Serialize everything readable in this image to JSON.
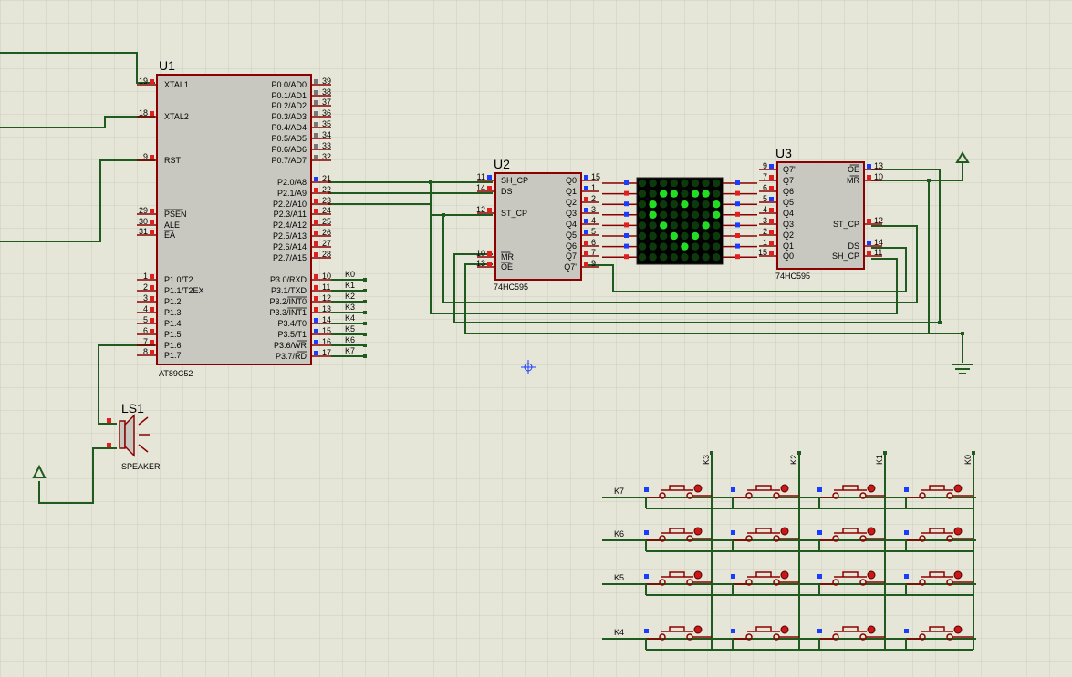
{
  "u1": {
    "ref": "U1",
    "part": "AT89C52",
    "left_pins": [
      {
        "num": "19",
        "name": "XTAL1"
      },
      {
        "num": "18",
        "name": "XTAL2"
      },
      {
        "num": "9",
        "name": "RST"
      },
      {
        "num": "29",
        "name": "PSEN"
      },
      {
        "num": "30",
        "name": "ALE"
      },
      {
        "num": "31",
        "name": "EA"
      },
      {
        "num": "1",
        "name": "P1.0/T2"
      },
      {
        "num": "2",
        "name": "P1.1/T2EX"
      },
      {
        "num": "3",
        "name": "P1.2"
      },
      {
        "num": "4",
        "name": "P1.3"
      },
      {
        "num": "5",
        "name": "P1.4"
      },
      {
        "num": "6",
        "name": "P1.5"
      },
      {
        "num": "7",
        "name": "P1.6"
      },
      {
        "num": "8",
        "name": "P1.7"
      }
    ],
    "right_pins": [
      {
        "num": "39",
        "name": "P0.0/AD0"
      },
      {
        "num": "38",
        "name": "P0.1/AD1"
      },
      {
        "num": "37",
        "name": "P0.2/AD2"
      },
      {
        "num": "36",
        "name": "P0.3/AD3"
      },
      {
        "num": "35",
        "name": "P0.4/AD4"
      },
      {
        "num": "34",
        "name": "P0.5/AD5"
      },
      {
        "num": "33",
        "name": "P0.6/AD6"
      },
      {
        "num": "32",
        "name": "P0.7/AD7"
      },
      {
        "num": "21",
        "name": "P2.0/A8"
      },
      {
        "num": "22",
        "name": "P2.1/A9"
      },
      {
        "num": "23",
        "name": "P2.2/A10"
      },
      {
        "num": "24",
        "name": "P2.3/A11"
      },
      {
        "num": "25",
        "name": "P2.4/A12"
      },
      {
        "num": "26",
        "name": "P2.5/A13"
      },
      {
        "num": "27",
        "name": "P2.6/A14"
      },
      {
        "num": "28",
        "name": "P2.7/A15"
      },
      {
        "num": "10",
        "name": "P3.0/RXD",
        "net": "K0"
      },
      {
        "num": "11",
        "name": "P3.1/TXD",
        "net": "K1"
      },
      {
        "num": "12",
        "name": "P3.2/INT0",
        "net": "K2"
      },
      {
        "num": "13",
        "name": "P3.3/INT1",
        "net": "K3"
      },
      {
        "num": "14",
        "name": "P3.4/T0",
        "net": "K4"
      },
      {
        "num": "15",
        "name": "P3.5/T1",
        "net": "K5"
      },
      {
        "num": "16",
        "name": "P3.6/WR",
        "net": "K6"
      },
      {
        "num": "17",
        "name": "P3.7/RD",
        "net": "K7"
      }
    ]
  },
  "u2": {
    "ref": "U2",
    "part": "74HC595",
    "left_pins": [
      {
        "num": "11",
        "name": "SH_CP"
      },
      {
        "num": "14",
        "name": "DS"
      },
      {
        "num": "12",
        "name": "ST_CP"
      },
      {
        "num": "10",
        "name": "MR"
      },
      {
        "num": "13",
        "name": "OE"
      }
    ],
    "right_pins": [
      {
        "num": "15",
        "name": "Q0"
      },
      {
        "num": "1",
        "name": "Q1"
      },
      {
        "num": "2",
        "name": "Q2"
      },
      {
        "num": "3",
        "name": "Q3"
      },
      {
        "num": "4",
        "name": "Q4"
      },
      {
        "num": "5",
        "name": "Q5"
      },
      {
        "num": "6",
        "name": "Q6"
      },
      {
        "num": "7",
        "name": "Q7"
      },
      {
        "num": "9",
        "name": "Q7'"
      }
    ]
  },
  "u3": {
    "ref": "U3",
    "part": "74HC595",
    "left_pins": [
      {
        "num": "9",
        "name": "Q7'"
      },
      {
        "num": "7",
        "name": "Q7"
      },
      {
        "num": "6",
        "name": "Q6"
      },
      {
        "num": "5",
        "name": "Q5"
      },
      {
        "num": "4",
        "name": "Q4"
      },
      {
        "num": "3",
        "name": "Q3"
      },
      {
        "num": "2",
        "name": "Q2"
      },
      {
        "num": "1",
        "name": "Q1"
      },
      {
        "num": "15",
        "name": "Q0"
      }
    ],
    "right_pins": [
      {
        "num": "13",
        "name": "OE"
      },
      {
        "num": "10",
        "name": "MR"
      },
      {
        "num": "12",
        "name": "ST_CP"
      },
      {
        "num": "14",
        "name": "DS"
      },
      {
        "num": "11",
        "name": "SH_CP"
      }
    ]
  },
  "speaker": {
    "ref": "LS1",
    "part": "SPEAKER"
  },
  "keypad": {
    "row_labels": [
      "K7",
      "K6",
      "K5",
      "K4"
    ],
    "col_labels": [
      "K3",
      "K2",
      "K1",
      "K0"
    ]
  },
  "matrix": {
    "on_pattern": [
      "00000000",
      "00110110",
      "01001001",
      "01000001",
      "00100010",
      "00010100",
      "00001000",
      "00000000"
    ]
  },
  "colors": {
    "background": "#e6e6d8",
    "grid": "#cfcfbf",
    "wire": "#1f5a1f",
    "body_fill": "#c8c8c0",
    "body_stroke": "#8b0000",
    "pin_red": "#e02020",
    "pin_blue": "#1a3cff",
    "led_on": "#22dd22",
    "led_off": "#0c3a0c"
  }
}
